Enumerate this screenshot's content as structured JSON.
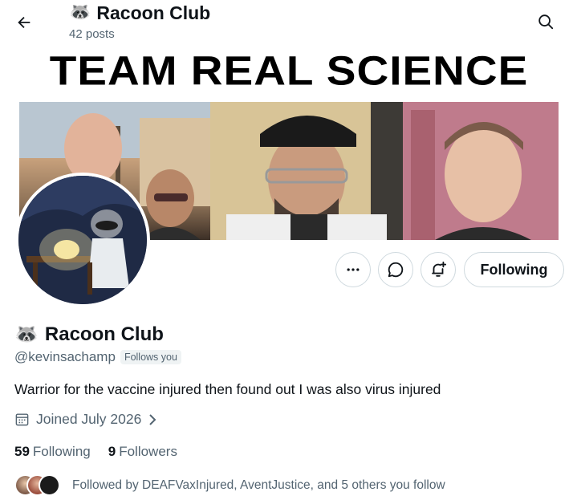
{
  "header": {
    "emoji": "🦝",
    "title": "Racoon Club",
    "post_count": "42 posts",
    "back_icon": "back-arrow-icon",
    "search_icon": "search-icon"
  },
  "banner": {
    "heading": "TEAM REAL SCIENCE"
  },
  "actions": {
    "more_icon": "more-icon",
    "message_icon": "message-icon",
    "notify_icon": "notification-bell-icon",
    "following_label": "Following"
  },
  "profile": {
    "emoji": "🦝",
    "name": "Racoon Club",
    "handle": "@kevinsachamp",
    "follows_you": "Follows you",
    "bio": "Warrior for the vaccine injured then found out I was also virus injured",
    "joined": "Joined July 2026",
    "following_count": "59",
    "following_label": "Following",
    "followers_count": "9",
    "followers_label": "Followers",
    "followed_by": "Followed by DEAFVaxInjured, AventJustice, and 5 others you follow"
  },
  "colors": {
    "text_primary": "#0f1419",
    "text_secondary": "#536471",
    "border": "#cfd9de"
  }
}
